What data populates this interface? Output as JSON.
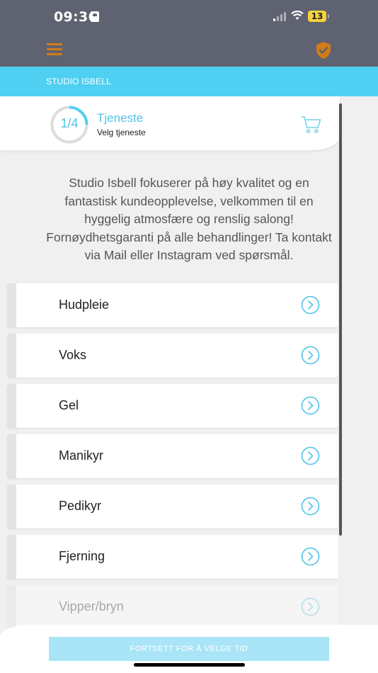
{
  "status_bar": {
    "time": "09:36",
    "battery": "13"
  },
  "header": {
    "menu_icon": "hamburger-icon",
    "shield_icon": "shield-check-icon"
  },
  "studio": {
    "name": "STUDIO ISBELL"
  },
  "step": {
    "progress_text": "1/4",
    "progress_fraction": 0.25,
    "title": "Tjeneste",
    "subtitle": "Velg tjeneste",
    "cart_icon": "cart-icon"
  },
  "description": "Studio Isbell fokuserer på høy kvalitet og en fantastisk kundeopplevelse, velkommen til en hyggelig atmosfære og renslig salong! Fornøydhetsgaranti på alle behandlinger! Ta kontakt via Mail eller Instagram ved spørsmål.",
  "services": [
    {
      "label": "Hudpleie"
    },
    {
      "label": "Voks"
    },
    {
      "label": "Gel"
    },
    {
      "label": "Manikyr"
    },
    {
      "label": "Pedikyr"
    },
    {
      "label": "Fjerning"
    },
    {
      "label": "Vipper/bryn"
    }
  ],
  "footer": {
    "continue_label": "FORTSETT FOR Å VELGE TID"
  },
  "colors": {
    "accent": "#4fd0f2",
    "brand_orange": "#d07c1a",
    "header_bg": "#5f6270"
  }
}
